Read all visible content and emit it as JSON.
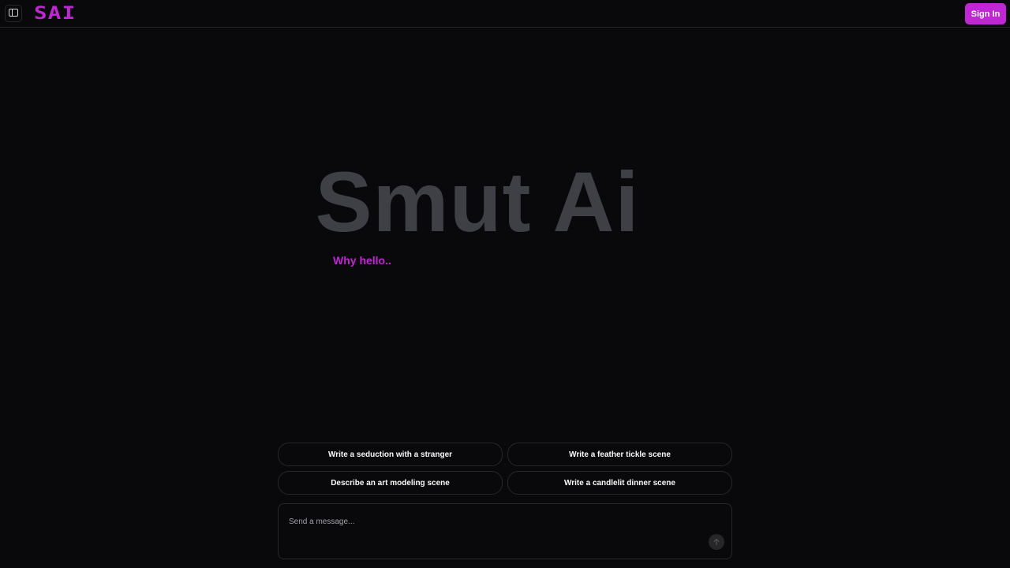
{
  "header": {
    "logo_text": "SAI",
    "sign_in_label": "Sign In",
    "icons": {
      "sidebar_toggle": "sidebar-panel-icon"
    }
  },
  "hero": {
    "title": "Smut Ai",
    "subtitle": "Why hello.."
  },
  "suggestions": [
    {
      "label": "Write a seduction with a stranger"
    },
    {
      "label": "Write a feather tickle scene"
    },
    {
      "label": "Describe an art modeling scene"
    },
    {
      "label": "Write a candlelit dinner scene"
    }
  ],
  "composer": {
    "placeholder": "Send a message...",
    "send_icon": "arrow-up-icon"
  },
  "colors": {
    "background": "#09090b",
    "accent": "#c026d3",
    "border": "#27272a",
    "title_gray": "#3f3f46"
  }
}
